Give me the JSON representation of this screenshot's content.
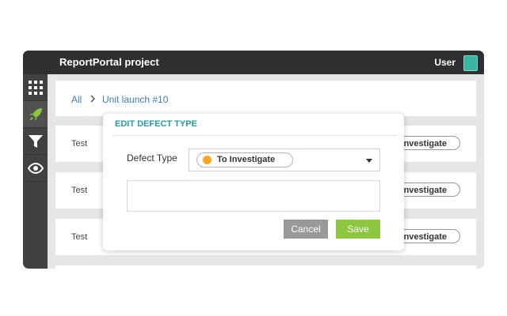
{
  "header": {
    "project_title": "ReportPortal project",
    "user_label": "User"
  },
  "sidebar": {
    "items": [
      {
        "icon": "grid-icon"
      },
      {
        "icon": "rocket-icon",
        "active": true
      },
      {
        "icon": "filter-icon"
      },
      {
        "icon": "eye-icon"
      }
    ]
  },
  "breadcrumb": {
    "all": "All",
    "launch": "Unit launch #10"
  },
  "rows": [
    {
      "label": "Test",
      "status": "nvestigate"
    },
    {
      "label": "Test",
      "status": "nvestigate"
    },
    {
      "label": "Test",
      "status": "nvestigate"
    }
  ],
  "modal": {
    "title": "EDIT DEFECT TYPE",
    "field_label": "Defect Type",
    "selected_type": "To Investigate",
    "comment_value": "",
    "cancel_label": "Cancel",
    "save_label": "Save"
  },
  "colors": {
    "accent": "#1e9fab",
    "save": "#8dc63f",
    "cancel": "#999999",
    "to_investigate": "#f5a623"
  }
}
